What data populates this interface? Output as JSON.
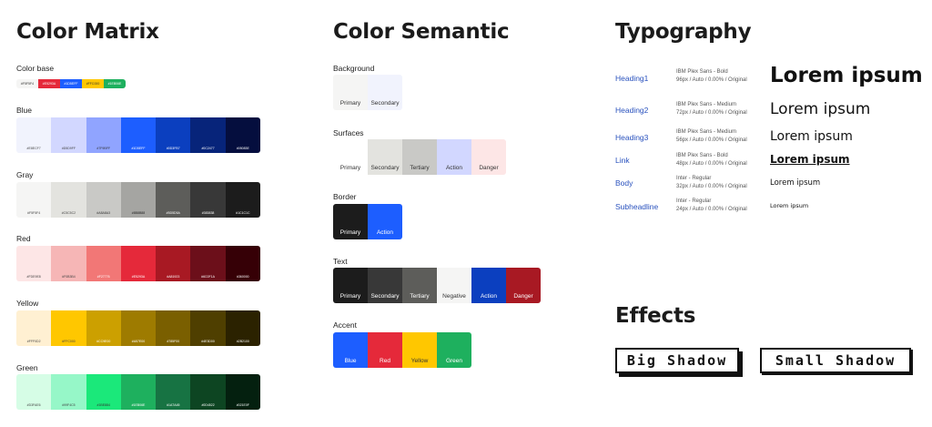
{
  "matrix": {
    "title": "Color Matrix",
    "base_label": "Color base",
    "base": [
      {
        "code": "#F5F5F4",
        "color": "#F5F5F4",
        "fg": "#333"
      },
      {
        "code": "#E5293A",
        "color": "#E5293A",
        "fg": "#fff"
      },
      {
        "code": "#1D5EFF",
        "color": "#1D5EFF",
        "fg": "#fff"
      },
      {
        "code": "#FFC000",
        "color": "#FFC700",
        "fg": "#333"
      },
      {
        "code": "#1EB06E",
        "color": "#1EB05E",
        "fg": "#fff"
      }
    ],
    "ramps": [
      {
        "name": "Blue",
        "swatches": [
          {
            "code": "#E8ECF7",
            "color": "#F1F3FD",
            "fg": "#444"
          },
          {
            "code": "#D5D9FF",
            "color": "#D2D7FF",
            "fg": "#444"
          },
          {
            "code": "#7F9BFF",
            "color": "#90A4FF",
            "fg": "#333"
          },
          {
            "code": "#1D5EFF",
            "color": "#1D5EFF",
            "fg": "#fff"
          },
          {
            "code": "#0D3FB7",
            "color": "#0B3FBF",
            "fg": "#fff"
          },
          {
            "code": "#0C2477",
            "color": "#07247A",
            "fg": "#fff"
          },
          {
            "code": "#05083E",
            "color": "#050E3E",
            "fg": "#fff"
          }
        ]
      },
      {
        "name": "Gray",
        "swatches": [
          {
            "code": "#F5F5F4",
            "color": "#F5F5F4",
            "fg": "#444"
          },
          {
            "code": "#C5C5C2",
            "color": "#E3E3DF",
            "fg": "#444"
          },
          {
            "code": "#A8A8A3",
            "color": "#C9C9C6",
            "fg": "#333"
          },
          {
            "code": "#8B8B88",
            "color": "#A5A5A2",
            "fg": "#222"
          },
          {
            "code": "#5D5D5A",
            "color": "#5D5D5A",
            "fg": "#fff"
          },
          {
            "code": "#383838",
            "color": "#383838",
            "fg": "#fff"
          },
          {
            "code": "#1C1C1C",
            "color": "#1C1C1C",
            "fg": "#fff"
          }
        ]
      },
      {
        "name": "Red",
        "swatches": [
          {
            "code": "#FDE9E8",
            "color": "#FDE6E6",
            "fg": "#444"
          },
          {
            "code": "#F0B3B4",
            "color": "#F6B6B6",
            "fg": "#444"
          },
          {
            "code": "#F27776",
            "color": "#F27776",
            "fg": "#fff"
          },
          {
            "code": "#E5293A",
            "color": "#E5293A",
            "fg": "#fff"
          },
          {
            "code": "#A81923",
            "color": "#A81923",
            "fg": "#fff"
          },
          {
            "code": "#6C0F1A",
            "color": "#6C0F1A",
            "fg": "#fff"
          },
          {
            "code": "#360000",
            "color": "#360006",
            "fg": "#fff"
          }
        ]
      },
      {
        "name": "Yellow",
        "swatches": [
          {
            "code": "#FFF0D2",
            "color": "#FFF0D2",
            "fg": "#444"
          },
          {
            "code": "#FFC000",
            "color": "#FFC700",
            "fg": "#444"
          },
          {
            "code": "#CC9E00",
            "color": "#CCA000",
            "fg": "#fff"
          },
          {
            "code": "#A57E00",
            "color": "#9E7B00",
            "fg": "#fff"
          },
          {
            "code": "#785F00",
            "color": "#7A5F00",
            "fg": "#fff"
          },
          {
            "code": "#4E3D00",
            "color": "#4F3F00",
            "fg": "#fff"
          },
          {
            "code": "#2B2100",
            "color": "#2B2200",
            "fg": "#fff"
          }
        ]
      },
      {
        "name": "Green",
        "swatches": [
          {
            "code": "#D3FAE6",
            "color": "#D6FDE6",
            "fg": "#444"
          },
          {
            "code": "#99F4C5",
            "color": "#96F7C8",
            "fg": "#444"
          },
          {
            "code": "#1BE884",
            "color": "#1BE87A",
            "fg": "#333"
          },
          {
            "code": "#1EB06E",
            "color": "#1EB05E",
            "fg": "#fff"
          },
          {
            "code": "#1A7A45",
            "color": "#177343",
            "fg": "#fff"
          },
          {
            "code": "#0D4522",
            "color": "#0D4522",
            "fg": "#fff"
          },
          {
            "code": "#021E0F",
            "color": "#04200F",
            "fg": "#fff"
          }
        ]
      }
    ]
  },
  "semantic": {
    "title": "Color Semantic",
    "groups": [
      {
        "name": "Background",
        "swatches": [
          {
            "label": "Primary",
            "color": "#F5F5F4",
            "fg": "#333"
          },
          {
            "label": "Secondary",
            "color": "#F1F3FD",
            "fg": "#333"
          }
        ]
      },
      {
        "name": "Surfaces",
        "swatches": [
          {
            "label": "Primary",
            "color": "#FFFFFF",
            "fg": "#333"
          },
          {
            "label": "Secondary",
            "color": "#E3E3DF",
            "fg": "#333"
          },
          {
            "label": "Tertiary",
            "color": "#C9C9C6",
            "fg": "#333"
          },
          {
            "label": "Action",
            "color": "#D2D7FF",
            "fg": "#333"
          },
          {
            "label": "Danger",
            "color": "#FDE6E6",
            "fg": "#333"
          }
        ]
      },
      {
        "name": "Border",
        "swatches": [
          {
            "label": "Primary",
            "color": "#1C1C1C",
            "fg": "#fff"
          },
          {
            "label": "Action",
            "color": "#1D5EFF",
            "fg": "#fff"
          }
        ]
      },
      {
        "name": "Text",
        "swatches": [
          {
            "label": "Primary",
            "color": "#1C1C1C",
            "fg": "#fff"
          },
          {
            "label": "Secondary",
            "color": "#383838",
            "fg": "#fff"
          },
          {
            "label": "Tertiary",
            "color": "#5D5D5A",
            "fg": "#fff"
          },
          {
            "label": "Negative",
            "color": "#F5F5F4",
            "fg": "#333"
          },
          {
            "label": "Action",
            "color": "#0B3FBF",
            "fg": "#fff"
          },
          {
            "label": "Danger",
            "color": "#A81923",
            "fg": "#fff"
          }
        ]
      },
      {
        "name": "Accent",
        "swatches": [
          {
            "label": "Blue",
            "color": "#1D5EFF",
            "fg": "#fff"
          },
          {
            "label": "Red",
            "color": "#E5293A",
            "fg": "#fff"
          },
          {
            "label": "Yellow",
            "color": "#FFC700",
            "fg": "#333"
          },
          {
            "label": "Green",
            "color": "#1EB05E",
            "fg": "#fff"
          }
        ]
      }
    ]
  },
  "typography": {
    "title": "Typography",
    "styles": [
      {
        "name": "Heading1",
        "font": "IBM Plex Sans - Bold",
        "spec": "96px / Auto / 0.00% / Original",
        "sample": "Lorem ipsum"
      },
      {
        "name": "Heading2",
        "font": "IBM Plex Sans - Medium",
        "spec": "72px / Auto / 0.00% / Original",
        "sample": "Lorem ipsum"
      },
      {
        "name": "Heading3",
        "font": "IBM Plex Sans - Medium",
        "spec": "56px / Auto / 0.00% / Original",
        "sample": "Lorem ipsum"
      },
      {
        "name": "Link",
        "font": "IBM Plex Sans - Bold",
        "spec": "48px / Auto / 0.00% / Original",
        "sample": "Lorem ipsum"
      },
      {
        "name": "Body",
        "font": "Inter - Regular",
        "spec": "32px / Auto / 0.00% / Original",
        "sample": "Lorem ipsum"
      },
      {
        "name": "Subheadline",
        "font": "Inter - Regular",
        "spec": "24px / Auto / 0.00% / Original",
        "sample": "Lorem ipsum"
      }
    ]
  },
  "effects": {
    "title": "Effects",
    "big_shadow": "Big Shadow",
    "small_shadow": "Small Shadow"
  }
}
